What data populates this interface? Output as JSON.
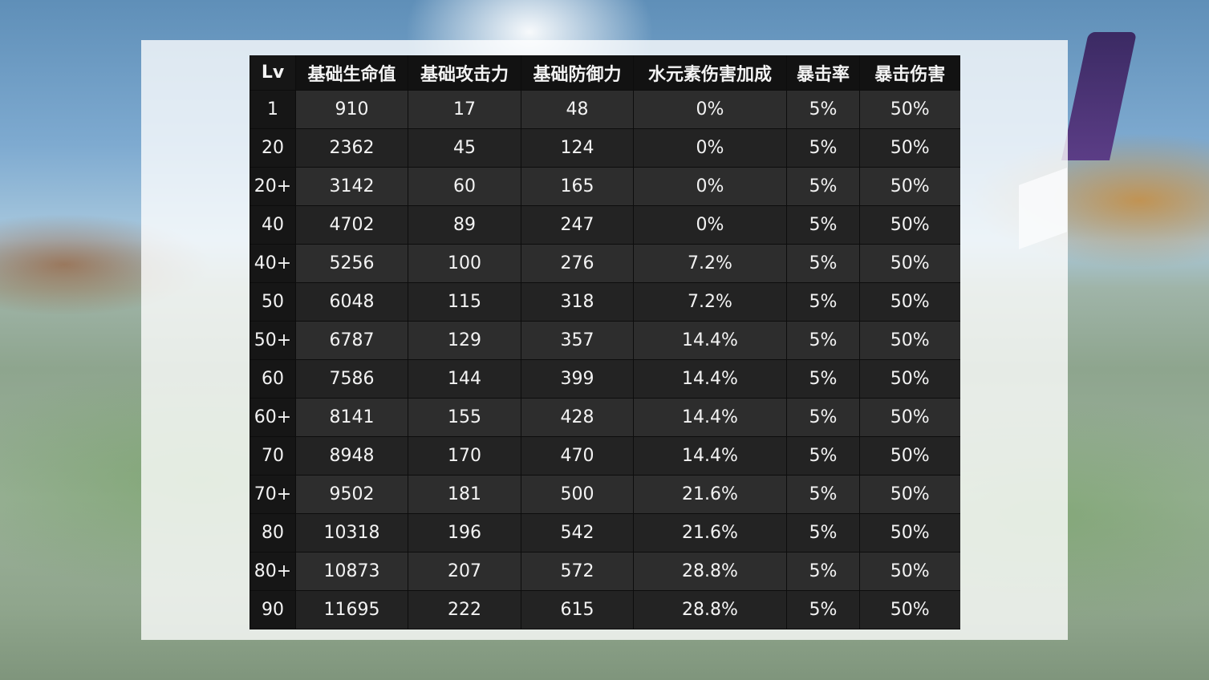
{
  "columns": [
    "Lv",
    "基础生命值",
    "基础攻击力",
    "基础防御力",
    "水元素伤害加成",
    "暴击率",
    "暴击伤害"
  ],
  "rows": [
    [
      "1",
      "910",
      "17",
      "48",
      "0%",
      "5%",
      "50%"
    ],
    [
      "20",
      "2362",
      "45",
      "124",
      "0%",
      "5%",
      "50%"
    ],
    [
      "20+",
      "3142",
      "60",
      "165",
      "0%",
      "5%",
      "50%"
    ],
    [
      "40",
      "4702",
      "89",
      "247",
      "0%",
      "5%",
      "50%"
    ],
    [
      "40+",
      "5256",
      "100",
      "276",
      "7.2%",
      "5%",
      "50%"
    ],
    [
      "50",
      "6048",
      "115",
      "318",
      "7.2%",
      "5%",
      "50%"
    ],
    [
      "50+",
      "6787",
      "129",
      "357",
      "14.4%",
      "5%",
      "50%"
    ],
    [
      "60",
      "7586",
      "144",
      "399",
      "14.4%",
      "5%",
      "50%"
    ],
    [
      "60+",
      "8141",
      "155",
      "428",
      "14.4%",
      "5%",
      "50%"
    ],
    [
      "70",
      "8948",
      "170",
      "470",
      "14.4%",
      "5%",
      "50%"
    ],
    [
      "70+",
      "9502",
      "181",
      "500",
      "21.6%",
      "5%",
      "50%"
    ],
    [
      "80",
      "10318",
      "196",
      "542",
      "21.6%",
      "5%",
      "50%"
    ],
    [
      "80+",
      "10873",
      "207",
      "572",
      "28.8%",
      "5%",
      "50%"
    ],
    [
      "90",
      "11695",
      "222",
      "615",
      "28.8%",
      "5%",
      "50%"
    ]
  ]
}
